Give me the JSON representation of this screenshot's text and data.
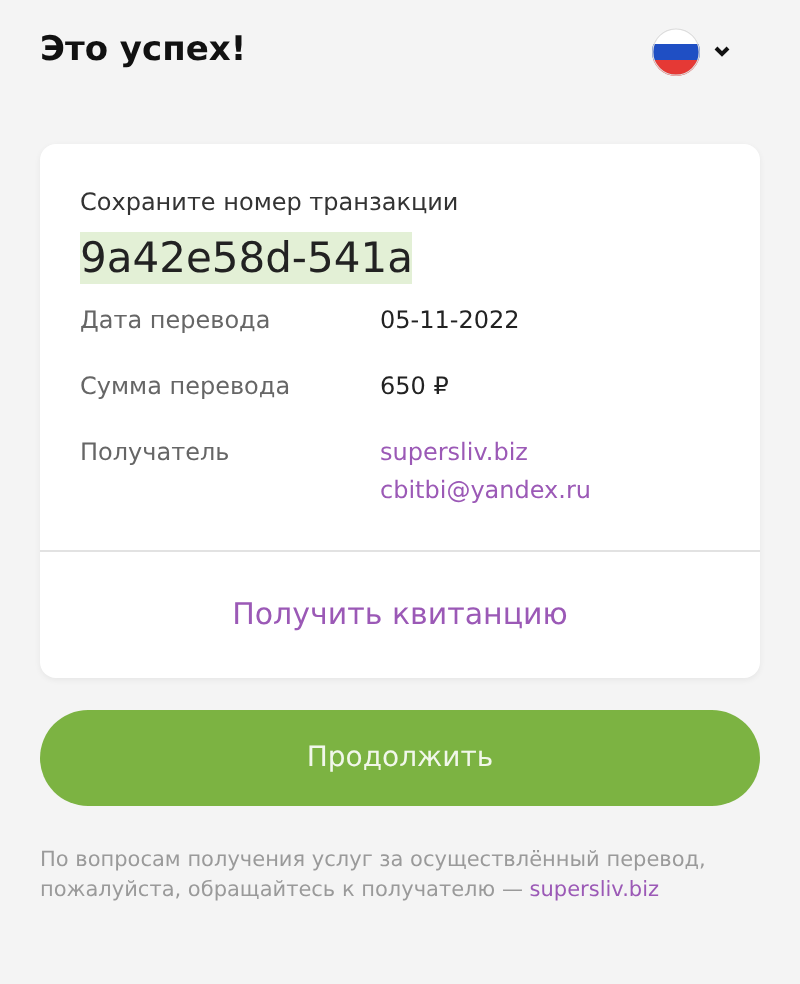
{
  "header": {
    "title": "Это успех!",
    "language": {
      "kind": "ru"
    }
  },
  "card": {
    "prompt": "Сохраните номер транзакции",
    "transaction_id": "9a42e58d-541a",
    "details": [
      {
        "label": "Дата перевода",
        "values": [
          "05-11-2022"
        ],
        "kind": "text"
      },
      {
        "label": "Сумма перевода",
        "values": [
          "650 ₽"
        ],
        "kind": "text"
      },
      {
        "label": "Получатель",
        "values": [
          "supersliv.biz",
          "cbitbi@yandex.ru"
        ],
        "kind": "link"
      }
    ],
    "receipt_link": "Получить квитанцию"
  },
  "continue_button": "Продолжить",
  "footer": {
    "text": "По вопросам получения услуг за осуществлённый перевод, пожалуйста, обращайтесь к получателю —",
    "link": "supersliv.biz"
  }
}
